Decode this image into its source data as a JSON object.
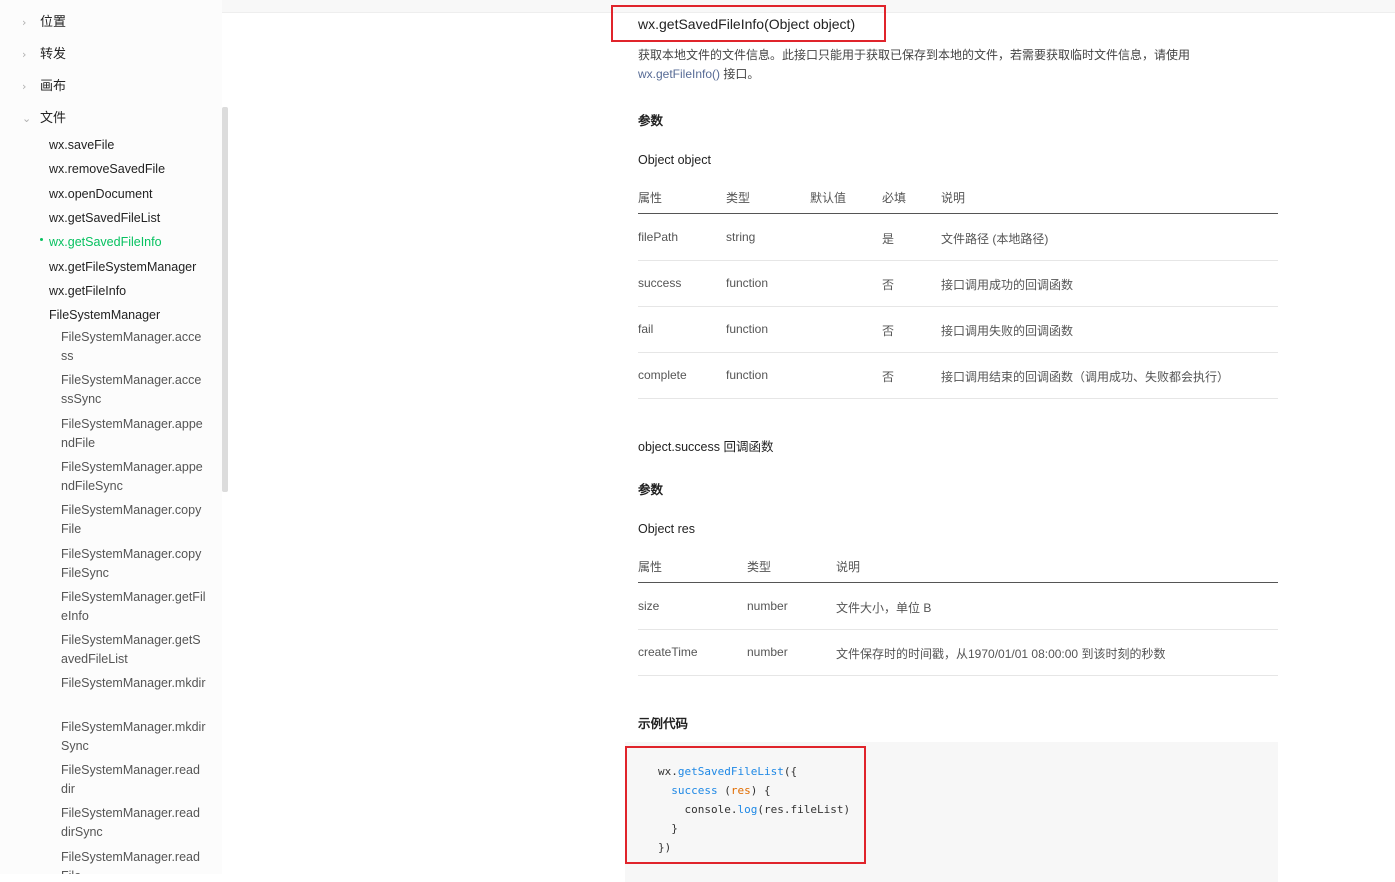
{
  "sidebar": {
    "categories": [
      {
        "label": "位置",
        "expanded": false
      },
      {
        "label": "转发",
        "expanded": false
      },
      {
        "label": "画布",
        "expanded": false
      },
      {
        "label": "文件",
        "expanded": true
      }
    ],
    "file_items": [
      {
        "label": "wx.saveFile"
      },
      {
        "label": "wx.removeSavedFile"
      },
      {
        "label": "wx.openDocument"
      },
      {
        "label": "wx.getSavedFileList"
      },
      {
        "label": "wx.getSavedFileInfo",
        "active": true
      },
      {
        "label": "wx.getFileSystemManager"
      },
      {
        "label": "wx.getFileInfo"
      },
      {
        "label": "FileSystemManager"
      }
    ],
    "fsm_items": [
      {
        "label": "FileSystemManager.access"
      },
      {
        "label": "FileSystemManager.accessSync"
      },
      {
        "label": "FileSystemManager.appendFile"
      },
      {
        "label": "FileSystemManager.appendFileSync"
      },
      {
        "label": "FileSystemManager.copyFile"
      },
      {
        "label": "FileSystemManager.copyFileSync"
      },
      {
        "label": "FileSystemManager.getFileInfo"
      },
      {
        "label": "FileSystemManager.getSavedFileList"
      },
      {
        "label": "FileSystemManager.mkdir"
      },
      {
        "label": "FileSystemManager.mkdirSync"
      },
      {
        "label": "FileSystemManager.readdir"
      },
      {
        "label": "FileSystemManager.readdirSync"
      },
      {
        "label": "FileSystemManager.readFile"
      }
    ]
  },
  "main": {
    "title": "wx.getSavedFileInfo(Object object)",
    "desc_text": "获取本地文件的文件信息。此接口只能用于获取已保存到本地的文件，若需要获取临时文件信息，请使用",
    "desc_link": "wx.getFileInfo()",
    "desc_tail": " 接口。",
    "params_heading": "参数",
    "object_heading": "Object object",
    "param_table": {
      "headers": [
        "属性",
        "类型",
        "默认值",
        "必填",
        "说明"
      ],
      "rows": [
        [
          "filePath",
          "string",
          "",
          "是",
          "文件路径 (本地路径)"
        ],
        [
          "success",
          "function",
          "",
          "否",
          "接口调用成功的回调函数"
        ],
        [
          "fail",
          "function",
          "",
          "否",
          "接口调用失败的回调函数"
        ],
        [
          "complete",
          "function",
          "",
          "否",
          "接口调用结束的回调函数（调用成功、失败都会执行）"
        ]
      ]
    },
    "success_heading": "object.success 回调函数",
    "params_heading2": "参数",
    "res_heading": "Object res",
    "res_table": {
      "headers": [
        "属性",
        "类型",
        "说明"
      ],
      "rows": [
        [
          "size",
          "number",
          "文件大小，单位 B"
        ],
        [
          "createTime",
          "number",
          "文件保存时的时间戳，从1970/01/01 08:00:00 到该时刻的秒数"
        ]
      ]
    },
    "example_heading": "示例代码",
    "code": {
      "l1_a": "wx.",
      "l1_b": "getSavedFileList",
      "l1_c": "({",
      "l2_a": "success",
      "l2_b": " (",
      "l2_c": "res",
      "l2_d": ") {",
      "l3_a": "console.",
      "l3_b": "log",
      "l3_c": "(res.fileList)",
      "l4": "}",
      "l5": "})"
    }
  },
  "colors": {
    "accent": "#07c160",
    "highlight_box": "#e0242b",
    "link": "#576b95"
  },
  "icons": {
    "collapsed": "chevron-right-icon",
    "expanded": "chevron-down-icon"
  }
}
